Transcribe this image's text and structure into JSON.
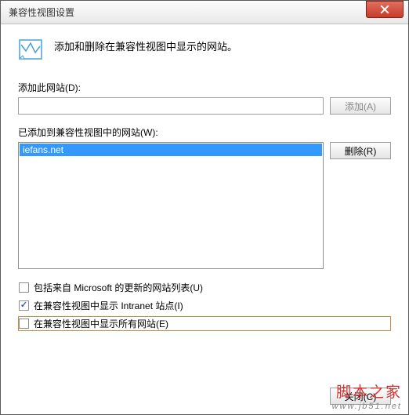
{
  "titlebar": {
    "title": "兼容性视图设置"
  },
  "header": {
    "text": "添加和删除在兼容性视图中显示的网站。"
  },
  "add_section": {
    "label": "添加此网站(D):",
    "input_value": "",
    "button": "添加(A)"
  },
  "list_section": {
    "label": "已添加到兼容性视图中的网站(W):",
    "items": [
      "iefans.net"
    ],
    "selected_index": 0,
    "button": "删除(R)"
  },
  "checkboxes": [
    {
      "label": "包括来自 Microsoft 的更新的网站列表(U)",
      "checked": false,
      "highlight": false
    },
    {
      "label": "在兼容性视图中显示 Intranet 站点(I)",
      "checked": true,
      "highlight": false
    },
    {
      "label": "在兼容性视图中显示所有网站(E)",
      "checked": false,
      "highlight": true
    }
  ],
  "footer": {
    "close": "关闭(C)"
  },
  "watermark": {
    "line1": "脚本之家",
    "line2": "www.jb51.net"
  }
}
